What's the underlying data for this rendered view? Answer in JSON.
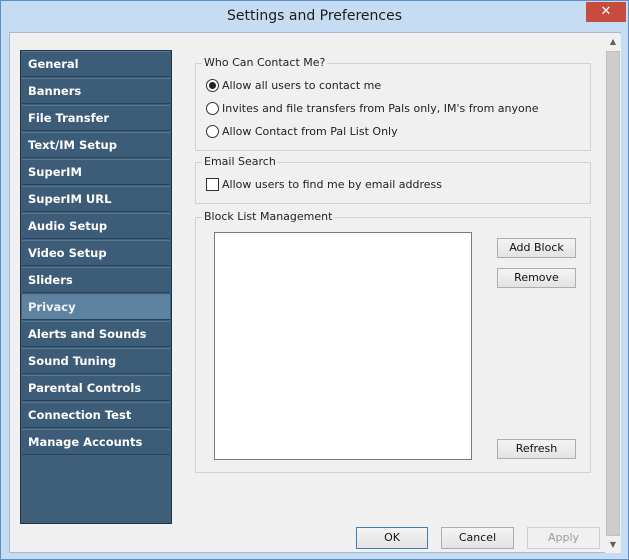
{
  "window": {
    "title": "Settings and Preferences",
    "close_glyph": "✕"
  },
  "sidebar": {
    "items": [
      {
        "label": "General"
      },
      {
        "label": "Banners"
      },
      {
        "label": "File Transfer"
      },
      {
        "label": "Text/IM Setup"
      },
      {
        "label": "SuperIM"
      },
      {
        "label": "SuperIM URL"
      },
      {
        "label": "Audio Setup"
      },
      {
        "label": "Video Setup"
      },
      {
        "label": "Sliders"
      },
      {
        "label": "Privacy"
      },
      {
        "label": "Alerts and Sounds"
      },
      {
        "label": "Sound Tuning"
      },
      {
        "label": "Parental Controls"
      },
      {
        "label": "Connection Test"
      },
      {
        "label": "Manage Accounts"
      }
    ],
    "selected": "Privacy"
  },
  "contact": {
    "label": "Who Can Contact Me?",
    "options": [
      {
        "label": "Allow all users to contact me",
        "selected": true
      },
      {
        "label": "Invites and file transfers from Pals only, IM's from anyone",
        "selected": false
      },
      {
        "label": "Allow Contact from Pal List Only",
        "selected": false
      }
    ]
  },
  "email_search": {
    "label": "Email Search",
    "checkbox_label": "Allow users to find me by email address",
    "checked": false
  },
  "block_list": {
    "label": "Block List Management",
    "add_label": "Add Block",
    "remove_label": "Remove",
    "refresh_label": "Refresh"
  },
  "footer": {
    "ok_label": "OK",
    "cancel_label": "Cancel",
    "apply_label": "Apply"
  },
  "scrollbar": {
    "up_glyph": "▲",
    "down_glyph": "▼"
  },
  "colors": {
    "sidebar_bg": "#3f5f79",
    "sidebar_selected": "#5e83a0",
    "close_button": "#c74b3f"
  }
}
